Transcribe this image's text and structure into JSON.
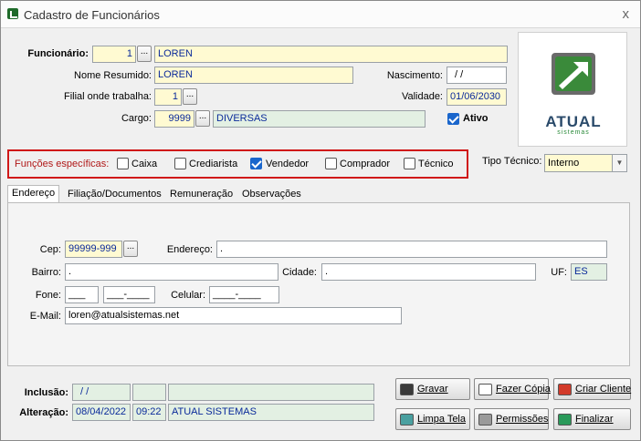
{
  "window": {
    "title": "Cadastro de Funcionários",
    "close_glyph": "x"
  },
  "employee": {
    "label": "Funcionário:",
    "code": "1",
    "name": "LOREN",
    "short_name_label": "Nome Resumido:",
    "short_name": "LOREN",
    "birth_label": "Nascimento:",
    "birth": "/ /",
    "branch_label": "Filial onde trabalha:",
    "branch": "1",
    "validity_label": "Validade:",
    "validity": "01/06/2030",
    "role_label": "Cargo:",
    "role_code": "9999",
    "role_name": "DIVERSAS",
    "active_label": "Ativo",
    "active": true
  },
  "browse_glyph": "...",
  "logo": {
    "brand": "ATUAL",
    "sub": "sistemas",
    "accent": "#2a8a3a"
  },
  "functions": {
    "label": "Funções específicas:",
    "items": [
      {
        "label": "Caixa",
        "checked": false
      },
      {
        "label": "Crediarista",
        "checked": false
      },
      {
        "label": "Vendedor",
        "checked": true
      },
      {
        "label": "Comprador",
        "checked": false
      },
      {
        "label": "Técnico",
        "checked": false
      }
    ],
    "highlight_color": "#d01818"
  },
  "tech_type": {
    "label": "Tipo Técnico:",
    "value": "Interno"
  },
  "tabs": [
    "Endereço",
    "Filiação/Documentos",
    "Remuneração",
    "Observações"
  ],
  "address": {
    "cep_label": "Cep:",
    "cep": "99999-999",
    "street_label": "Endereço:",
    "street": ".",
    "district_label": "Bairro:",
    "district": ".",
    "city_label": "Cidade:",
    "city": ".",
    "uf_label": "UF:",
    "uf": "ES",
    "phone_label": "Fone:",
    "phone_a": "___",
    "phone_b": "___-____",
    "mobile_label": "Celular:",
    "mobile": "____-____",
    "email_label": "E-Mail:",
    "email": "loren@atualsistemas.net"
  },
  "audit": {
    "inclusion_label": "Inclusão:",
    "inclusion_date": "/ /",
    "change_label": "Alteração:",
    "change_date": "08/04/2022",
    "change_time": "09:22",
    "change_user": "ATUAL SISTEMAS"
  },
  "buttons": {
    "save": "Gravar",
    "copy": "Fazer Cópia",
    "create_client": "Criar Cliente",
    "clear": "Limpa Tela",
    "permissions": "Permissões",
    "finish": "Finalizar"
  }
}
